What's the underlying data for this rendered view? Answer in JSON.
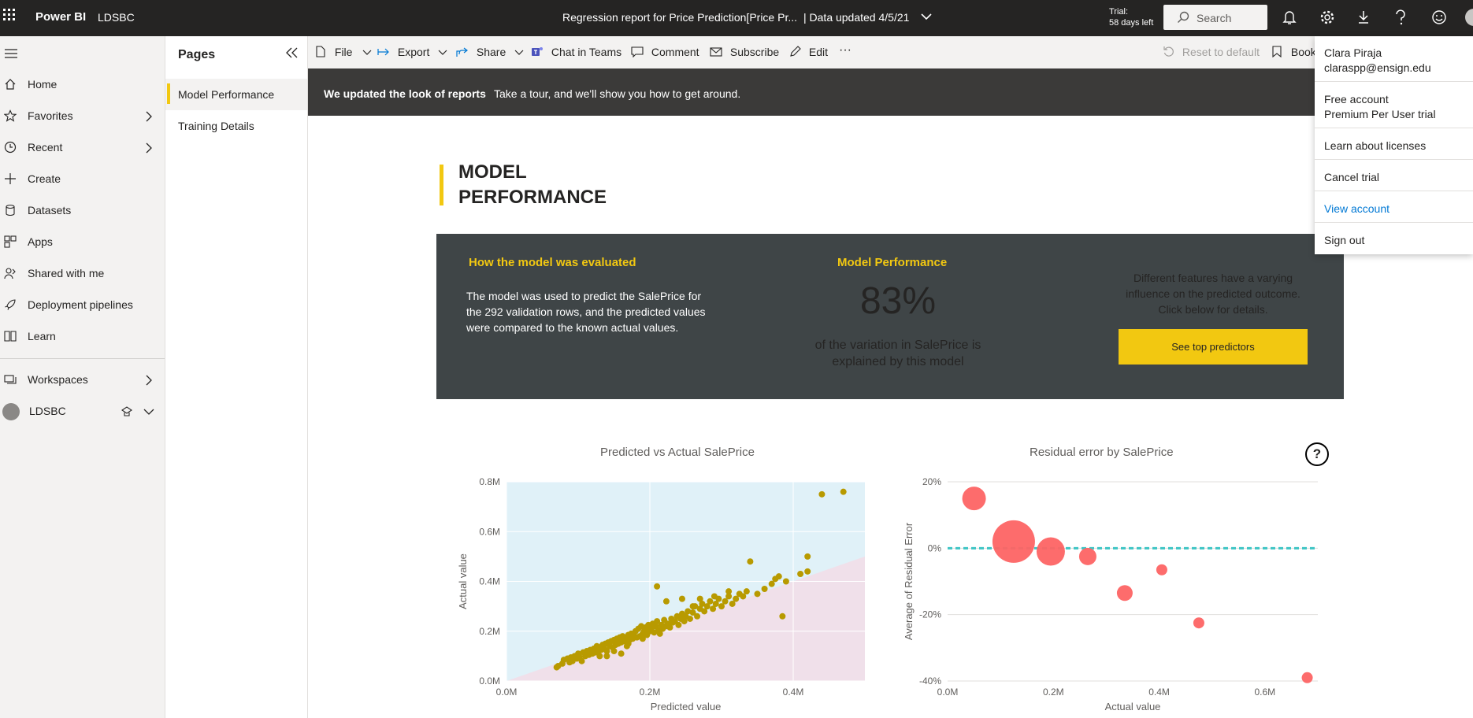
{
  "topbar": {
    "brand": "Power BI",
    "workspace": "LDSBC",
    "report_title": "Regression report for Price Prediction[Price Pr...",
    "data_updated": "| Data updated 4/5/21",
    "trial_line1": "Trial:",
    "trial_line2": "58 days left",
    "search_placeholder": "Search"
  },
  "leftnav": {
    "items": [
      {
        "label": "Home",
        "icon": "home-icon"
      },
      {
        "label": "Favorites",
        "icon": "star-icon"
      },
      {
        "label": "Recent",
        "icon": "clock-icon"
      },
      {
        "label": "Create",
        "icon": "plus-icon"
      },
      {
        "label": "Datasets",
        "icon": "database-icon"
      },
      {
        "label": "Apps",
        "icon": "apps-icon"
      },
      {
        "label": "Shared with me",
        "icon": "shared-icon"
      },
      {
        "label": "Deployment pipelines",
        "icon": "rocket-icon"
      },
      {
        "label": "Learn",
        "icon": "book-icon"
      },
      {
        "label": "Workspaces",
        "icon": "workspaces-icon"
      },
      {
        "label": "LDSBC",
        "icon": "workspace-avatar-icon"
      }
    ]
  },
  "pages": {
    "title": "Pages",
    "items": [
      "Model Performance",
      "Training Details"
    ]
  },
  "actionbar": {
    "file": "File",
    "export": "Export",
    "share": "Share",
    "chat": "Chat in Teams",
    "comment": "Comment",
    "subscribe": "Subscribe",
    "edit": "Edit",
    "more": "···",
    "reset": "Reset to default",
    "bookmarks": "Book"
  },
  "banner": {
    "bold": "We updated the look of reports",
    "text": "Take a tour, and we'll show you how to get around."
  },
  "report": {
    "title_line1": "MODEL",
    "title_line2": "PERFORMANCE",
    "eval_heading": "How the model was evaluated",
    "eval_text": "The model was used to predict the SalePrice for the 292 validation rows, and the predicted values were compared to the known actual values.",
    "perf_heading": "Model Performance",
    "perf_value": "83%",
    "perf_text": "of the variation in SalePrice is explained by this model",
    "features_text": "Different features have a varying influence on the predicted outcome. Click below for details.",
    "button": "See top predictors",
    "help": "?"
  },
  "colors": {
    "accent": "#f2c811",
    "card_bg": "#3f4547",
    "topbar": "#252423",
    "scatter_point": "#b89a00",
    "over_region": "#e0f1f8",
    "under_region": "#f0e0ea",
    "bubble": "#fd6464",
    "zero_line": "#3dc5c5",
    "link": "#0078d4"
  },
  "account_menu": {
    "name": "Clara Piraja",
    "email": "claraspp@ensign.edu",
    "plan1": "Free account",
    "plan2": "Premium Per User trial",
    "learn": "Learn about licenses",
    "cancel": "Cancel trial",
    "view": "View account",
    "signout": "Sign out"
  },
  "chart_data": [
    {
      "type": "scatter",
      "title": "Predicted vs Actual SalePrice",
      "xlabel": "Predicted value",
      "ylabel": "Actual value",
      "xlim": [
        0,
        0.5
      ],
      "ylim": [
        0,
        0.8
      ],
      "x_ticks": [
        "0.0M",
        "0.2M",
        "0.4M"
      ],
      "y_ticks": [
        "0.0M",
        "0.2M",
        "0.4M",
        "0.6M",
        "0.8M"
      ],
      "x_tick_values": [
        0,
        0.2,
        0.4
      ],
      "y_tick_values": [
        0,
        0.2,
        0.4,
        0.6,
        0.8
      ],
      "points": [
        [
          0.07,
          0.055
        ],
        [
          0.072,
          0.06
        ],
        [
          0.078,
          0.07
        ],
        [
          0.08,
          0.085
        ],
        [
          0.085,
          0.09
        ],
        [
          0.088,
          0.075
        ],
        [
          0.09,
          0.095
        ],
        [
          0.092,
          0.08
        ],
        [
          0.095,
          0.1
        ],
        [
          0.098,
          0.09
        ],
        [
          0.1,
          0.11
        ],
        [
          0.102,
          0.095
        ],
        [
          0.105,
          0.08
        ],
        [
          0.107,
          0.115
        ],
        [
          0.11,
          0.1
        ],
        [
          0.112,
          0.12
        ],
        [
          0.115,
          0.105
        ],
        [
          0.117,
          0.125
        ],
        [
          0.12,
          0.11
        ],
        [
          0.122,
          0.13
        ],
        [
          0.124,
          0.115
        ],
        [
          0.126,
          0.14
        ],
        [
          0.128,
          0.12
        ],
        [
          0.13,
          0.135
        ],
        [
          0.132,
          0.125
        ],
        [
          0.134,
          0.145
        ],
        [
          0.136,
          0.13
        ],
        [
          0.138,
          0.15
        ],
        [
          0.14,
          0.12
        ],
        [
          0.142,
          0.155
        ],
        [
          0.144,
          0.14
        ],
        [
          0.146,
          0.16
        ],
        [
          0.148,
          0.135
        ],
        [
          0.15,
          0.165
        ],
        [
          0.152,
          0.145
        ],
        [
          0.154,
          0.17
        ],
        [
          0.156,
          0.15
        ],
        [
          0.158,
          0.175
        ],
        [
          0.16,
          0.155
        ],
        [
          0.162,
          0.18
        ],
        [
          0.164,
          0.16
        ],
        [
          0.166,
          0.17
        ],
        [
          0.168,
          0.14
        ],
        [
          0.17,
          0.185
        ],
        [
          0.172,
          0.165
        ],
        [
          0.174,
          0.19
        ],
        [
          0.176,
          0.17
        ],
        [
          0.178,
          0.18
        ],
        [
          0.18,
          0.2
        ],
        [
          0.182,
          0.175
        ],
        [
          0.184,
          0.21
        ],
        [
          0.186,
          0.18
        ],
        [
          0.188,
          0.22
        ],
        [
          0.19,
          0.19
        ],
        [
          0.192,
          0.2
        ],
        [
          0.194,
          0.215
        ],
        [
          0.196,
          0.185
        ],
        [
          0.198,
          0.225
        ],
        [
          0.2,
          0.2
        ],
        [
          0.202,
          0.21
        ],
        [
          0.204,
          0.23
        ],
        [
          0.206,
          0.195
        ],
        [
          0.208,
          0.22
        ],
        [
          0.21,
          0.24
        ],
        [
          0.212,
          0.205
        ],
        [
          0.214,
          0.19
        ],
        [
          0.216,
          0.225
        ],
        [
          0.218,
          0.21
        ],
        [
          0.22,
          0.245
        ],
        [
          0.222,
          0.22
        ],
        [
          0.225,
          0.23
        ],
        [
          0.228,
          0.215
        ],
        [
          0.23,
          0.25
        ],
        [
          0.232,
          0.235
        ],
        [
          0.235,
          0.24
        ],
        [
          0.238,
          0.26
        ],
        [
          0.24,
          0.225
        ],
        [
          0.243,
          0.25
        ],
        [
          0.245,
          0.27
        ],
        [
          0.248,
          0.24
        ],
        [
          0.25,
          0.26
        ],
        [
          0.253,
          0.28
        ],
        [
          0.256,
          0.25
        ],
        [
          0.26,
          0.275
        ],
        [
          0.263,
          0.3
        ],
        [
          0.266,
          0.26
        ],
        [
          0.27,
          0.29
        ],
        [
          0.273,
          0.31
        ],
        [
          0.276,
          0.28
        ],
        [
          0.28,
          0.3
        ],
        [
          0.284,
          0.32
        ],
        [
          0.288,
          0.29
        ],
        [
          0.292,
          0.31
        ],
        [
          0.296,
          0.33
        ],
        [
          0.3,
          0.3
        ],
        [
          0.305,
          0.32
        ],
        [
          0.31,
          0.34
        ],
        [
          0.315,
          0.31
        ],
        [
          0.32,
          0.33
        ],
        [
          0.325,
          0.35
        ],
        [
          0.33,
          0.34
        ],
        [
          0.335,
          0.36
        ],
        [
          0.34,
          0.48
        ],
        [
          0.35,
          0.35
        ],
        [
          0.36,
          0.37
        ],
        [
          0.37,
          0.39
        ],
        [
          0.375,
          0.41
        ],
        [
          0.38,
          0.42
        ],
        [
          0.385,
          0.26
        ],
        [
          0.39,
          0.4
        ],
        [
          0.41,
          0.43
        ],
        [
          0.42,
          0.44
        ],
        [
          0.42,
          0.5
        ],
        [
          0.44,
          0.75
        ],
        [
          0.47,
          0.76
        ],
        [
          0.21,
          0.38
        ],
        [
          0.223,
          0.32
        ],
        [
          0.245,
          0.33
        ],
        [
          0.16,
          0.11
        ],
        [
          0.15,
          0.12
        ],
        [
          0.13,
          0.1
        ],
        [
          0.14,
          0.1
        ],
        [
          0.17,
          0.15
        ],
        [
          0.19,
          0.17
        ],
        [
          0.26,
          0.3
        ],
        [
          0.27,
          0.33
        ],
        [
          0.29,
          0.34
        ],
        [
          0.31,
          0.36
        ]
      ]
    },
    {
      "type": "scatter",
      "title": "Residual error by SalePrice",
      "xlabel": "Actual value",
      "ylabel": "Average of Residual Error",
      "xlim": [
        0,
        0.7
      ],
      "ylim": [
        -40,
        20
      ],
      "x_ticks": [
        "0.0M",
        "0.2M",
        "0.4M",
        "0.6M"
      ],
      "y_ticks": [
        "-40%",
        "-20%",
        "0%",
        "20%"
      ],
      "x_tick_values": [
        0,
        0.2,
        0.4,
        0.6
      ],
      "y_tick_values": [
        -40,
        -20,
        0,
        20
      ],
      "reference_line_y": 0,
      "bubbles": [
        {
          "x": 0.05,
          "y": 15,
          "size": 15
        },
        {
          "x": 0.125,
          "y": 2,
          "size": 27
        },
        {
          "x": 0.195,
          "y": -1,
          "size": 18
        },
        {
          "x": 0.265,
          "y": -2.5,
          "size": 11
        },
        {
          "x": 0.335,
          "y": -13.5,
          "size": 10
        },
        {
          "x": 0.405,
          "y": -6.5,
          "size": 7
        },
        {
          "x": 0.475,
          "y": -22.5,
          "size": 7
        },
        {
          "x": 0.68,
          "y": -39,
          "size": 7
        }
      ]
    }
  ]
}
